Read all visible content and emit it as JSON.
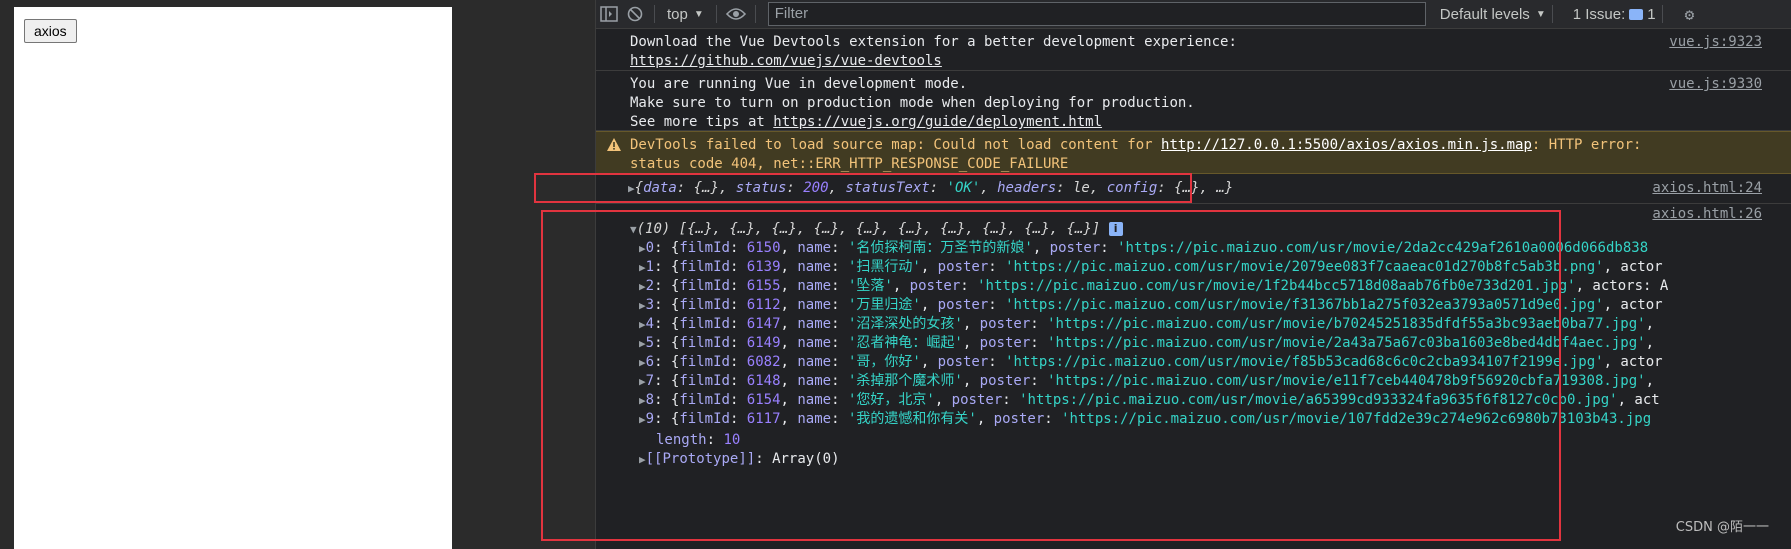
{
  "page": {
    "button_label": "axios"
  },
  "toolbar": {
    "context": "top",
    "filter_placeholder": "Filter",
    "levels": "Default levels",
    "issues": "1 Issue:",
    "issues_count": "1"
  },
  "messages": {
    "vue_devtools": {
      "line1": "Download the Vue Devtools extension for a better development experience:",
      "link": "https://github.com/vuejs/vue-devtools",
      "source": "vue.js:9323"
    },
    "vue_dev_mode": {
      "line1": "You are running Vue in development mode.",
      "line2": "Make sure to turn on production mode when deploying for production.",
      "line3_prefix": "See more tips at ",
      "link": "https://vuejs.org/guide/deployment.html",
      "source": "vue.js:9330"
    },
    "warning": {
      "prefix": "DevTools failed to load source map: Could not load content for ",
      "link": "http://127.0.0.1:5500/axios/axios.min.js.map",
      "suffix": ": HTTP error:",
      "line2": "status code 404, net::ERR_HTTP_RESPONSE_CODE_FAILURE"
    },
    "response": {
      "text_open": "{",
      "data_key": "data",
      "data_val": "{…}",
      "status_key": "status",
      "status_val": "200",
      "statusText_key": "statusText",
      "statusText_val": "'OK'",
      "headers_key": "headers",
      "headers_val": "le",
      "config_key": "config",
      "config_val": "{…}",
      "tail": "…}",
      "source": "axios.html:24"
    },
    "array": {
      "header_count": "(10)",
      "header_items": "[{…}, {…}, {…}, {…}, {…}, {…}, {…}, {…}, {…}, {…}]",
      "source": "axios.html:26",
      "rows": [
        {
          "idx": "0",
          "filmId": "6150",
          "name": "'名侦探柯南：万圣节的新娘'",
          "poster": "'https://pic.maizuo.com/usr/movie/2da2cc429af2610a0006d066db838",
          "tail": ""
        },
        {
          "idx": "1",
          "filmId": "6139",
          "name": "'扫黑行动'",
          "poster": "'https://pic.maizuo.com/usr/movie/2079ee083f7caaeac01d270b8fc5ab3b.png'",
          "tail": ", actor"
        },
        {
          "idx": "2",
          "filmId": "6155",
          "name": "'坠落'",
          "poster": "'https://pic.maizuo.com/usr/movie/1f2b44bcc5718d08aab76fb0e733d201.jpg'",
          "tail": ", actors: A"
        },
        {
          "idx": "3",
          "filmId": "6112",
          "name": "'万里归途'",
          "poster": "'https://pic.maizuo.com/usr/movie/f31367bb1a275f032ea3793a0571d9e0.jpg'",
          "tail": ", actor"
        },
        {
          "idx": "4",
          "filmId": "6147",
          "name": "'沼泽深处的女孩'",
          "poster": "'https://pic.maizuo.com/usr/movie/b70245251835dfdf55a3bc93aeb0ba77.jpg'",
          "tail": ","
        },
        {
          "idx": "5",
          "filmId": "6149",
          "name": "'忍者神龟：崛起'",
          "poster": "'https://pic.maizuo.com/usr/movie/2a43a75a67c03ba1603e8bed4dbf4aec.jpg'",
          "tail": ","
        },
        {
          "idx": "6",
          "filmId": "6082",
          "name": "'哥，你好'",
          "poster": "'https://pic.maizuo.com/usr/movie/f85b53cad68c6c0c2cba934107f2199e.jpg'",
          "tail": ", actor"
        },
        {
          "idx": "7",
          "filmId": "6148",
          "name": "'杀掉那个魔术师'",
          "poster": "'https://pic.maizuo.com/usr/movie/e11f7ceb440478b9f56920cbfa719308.jpg'",
          "tail": ","
        },
        {
          "idx": "8",
          "filmId": "6154",
          "name": "'您好，北京'",
          "poster": "'https://pic.maizuo.com/usr/movie/a65399cd933324fa9635f6f8127c0cb0.jpg'",
          "tail": ", act"
        },
        {
          "idx": "9",
          "filmId": "6117",
          "name": "'我的遗憾和你有关'",
          "poster": "'https://pic.maizuo.com/usr/movie/107fdd2e39c274e962c6980b73103b43.jpg",
          "tail": ""
        }
      ],
      "length_key": "length",
      "length_val": "10",
      "proto_key": "[[Prototype]]",
      "proto_val": "Array(0)"
    }
  },
  "watermark": "CSDN @陌一一"
}
